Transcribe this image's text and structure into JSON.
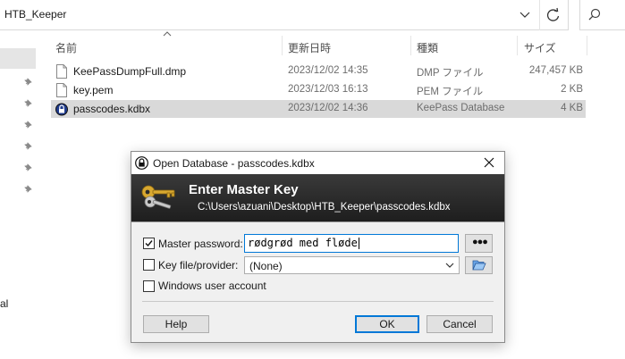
{
  "explorer": {
    "address_path": "HTB_Keeper",
    "search_placeholder": "",
    "nav_partial_label": "al",
    "columns": {
      "name": "名前",
      "modified": "更新日時",
      "type": "種類",
      "size": "サイズ"
    },
    "files": [
      {
        "name": "KeePassDumpFull.dmp",
        "modified": "2023/12/02 14:35",
        "type": "DMP ファイル",
        "size": "247,457 KB",
        "icon": "file-icon"
      },
      {
        "name": "key.pem",
        "modified": "2023/12/03 16:13",
        "type": "PEM ファイル",
        "size": "2 KB",
        "icon": "file-icon"
      },
      {
        "name": "passcodes.kdbx",
        "modified": "2023/12/02 14:36",
        "type": "KeePass Database",
        "size": "4 KB",
        "icon": "keepass-lock-icon"
      }
    ]
  },
  "dialog": {
    "title": "Open Database - passcodes.kdbx",
    "banner_title": "Enter Master Key",
    "banner_path": "C:\\Users\\azuani\\Desktop\\HTB_Keeper\\passcodes.kdbx",
    "master_password_label": "Master password:",
    "master_password_checked": true,
    "master_password_value": "rødgrød med fløde",
    "reveal_label": "●●●",
    "keyfile_label": "Key file/provider:",
    "keyfile_checked": false,
    "keyfile_value": "(None)",
    "windows_account_label": "Windows user account",
    "windows_account_checked": false,
    "help_label": "Help",
    "ok_label": "OK",
    "cancel_label": "Cancel"
  },
  "colors": {
    "selection_row": "#d9d9d9",
    "banner_bg": "#2a2a2a",
    "focus_border": "#0078d7"
  }
}
